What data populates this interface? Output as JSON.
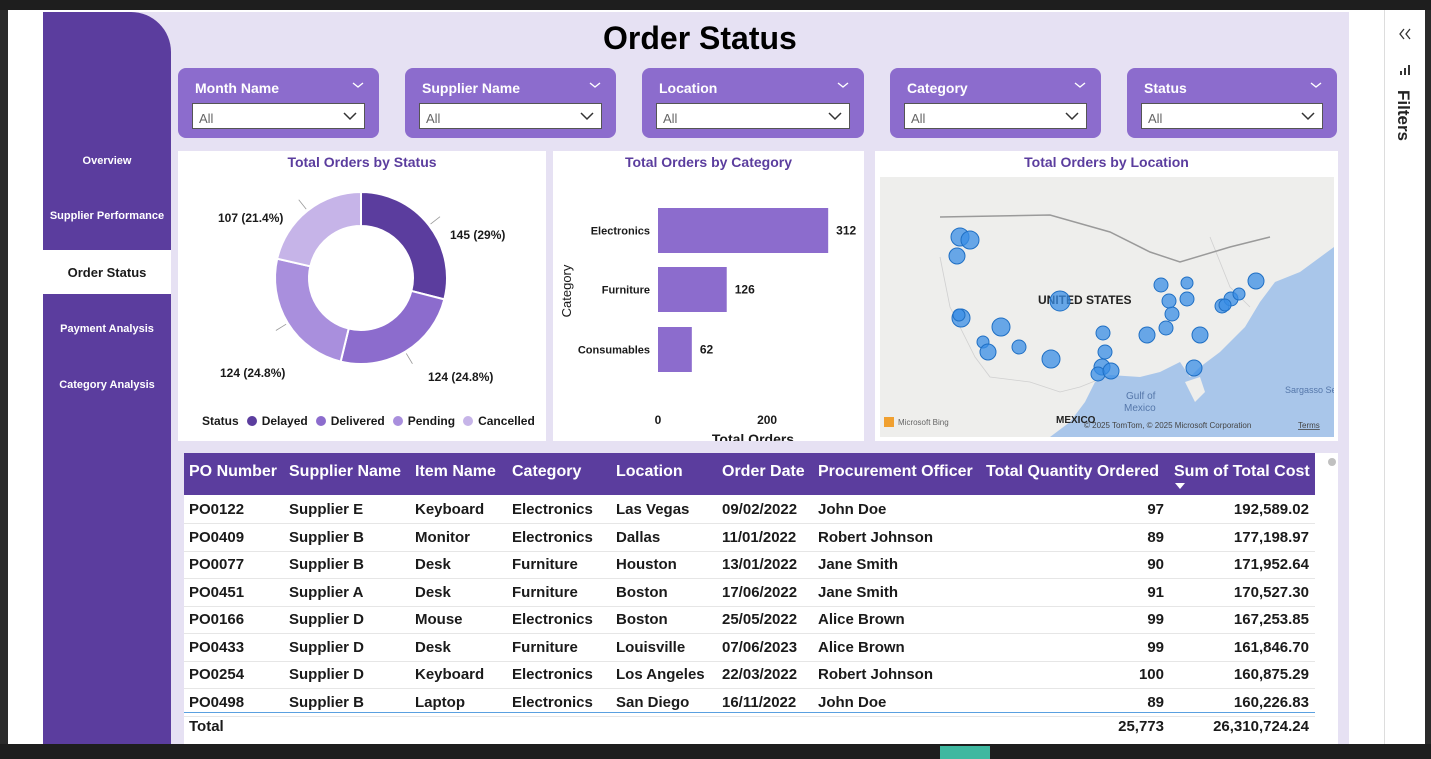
{
  "report": {
    "title": "Order Status"
  },
  "nav": {
    "items": [
      {
        "label": "Overview"
      },
      {
        "label": "Supplier Performance"
      },
      {
        "label": "Order Status"
      },
      {
        "label": "Payment Analysis"
      },
      {
        "label": "Category Analysis"
      }
    ],
    "active": "Order Status"
  },
  "slicers": [
    {
      "label": "Month Name",
      "value": "All"
    },
    {
      "label": "Supplier Name",
      "value": "All"
    },
    {
      "label": "Location",
      "value": "All"
    },
    {
      "label": "Category",
      "value": "All"
    },
    {
      "label": "Status",
      "value": "All"
    }
  ],
  "filters_pane": {
    "label": "Filters",
    "collapse_icon": "double-chevron-left-icon"
  },
  "colors": {
    "accent": "#5b3d9e",
    "slicer": "#8c6ccd",
    "background": "#e6e1f3",
    "delayed": "#5b3d9e",
    "delivered": "#8c6ccd",
    "pending": "#a98fdd",
    "cancelled": "#c6b4e8",
    "bar": "#8c6ccd",
    "map_point": "#3a8ee6"
  },
  "chart_data": [
    {
      "type": "pie",
      "title": "Total Orders by Status",
      "legend_title": "Status",
      "legend_position": "bottom",
      "categories": [
        "Delayed",
        "Delivered",
        "Pending",
        "Cancelled"
      ],
      "values": [
        145,
        124,
        124,
        107
      ],
      "labels": [
        "145 (29%)",
        "124 (24.8%)",
        "124 (24.8%)",
        "107 (21.4%)"
      ]
    },
    {
      "type": "bar",
      "orientation": "horizontal",
      "title": "Total Orders by Category",
      "xlabel": "Total Orders",
      "ylabel": "Category",
      "categories": [
        "Electronics",
        "Furniture",
        "Consumables"
      ],
      "values": [
        312,
        126,
        62
      ],
      "xticks": [
        "0",
        "200"
      ],
      "xlim": [
        0,
        330
      ]
    }
  ],
  "map": {
    "title": "Total Orders by Location",
    "country_label": "UNITED STATES",
    "labels": [
      "Gulf of Mexico",
      "MEXICO",
      "Sargasso Se"
    ],
    "attribution": "© 2025 TomTom, © 2025 Microsoft Corporation",
    "terms": "Terms",
    "provider": "Microsoft Bing"
  },
  "table": {
    "columns": [
      "PO Number",
      "Supplier Name",
      "Item Name",
      "Category",
      "Location",
      "Order Date",
      "Procurement Officer",
      "Total Quantity Ordered",
      "Sum of Total Cost"
    ],
    "sorted_column": "Sum of Total Cost",
    "rows": [
      [
        "PO0122",
        "Supplier E",
        "Keyboard",
        "Electronics",
        "Las Vegas",
        "09/02/2022",
        "John Doe",
        "97",
        "192,589.02"
      ],
      [
        "PO0409",
        "Supplier B",
        "Monitor",
        "Electronics",
        "Dallas",
        "11/01/2022",
        "Robert Johnson",
        "89",
        "177,198.97"
      ],
      [
        "PO0077",
        "Supplier B",
        "Desk",
        "Furniture",
        "Houston",
        "13/01/2022",
        "Jane Smith",
        "90",
        "171,952.64"
      ],
      [
        "PO0451",
        "Supplier A",
        "Desk",
        "Furniture",
        "Boston",
        "17/06/2022",
        "Jane Smith",
        "91",
        "170,527.30"
      ],
      [
        "PO0166",
        "Supplier D",
        "Mouse",
        "Electronics",
        "Boston",
        "25/05/2022",
        "Alice Brown",
        "99",
        "167,253.85"
      ],
      [
        "PO0433",
        "Supplier D",
        "Desk",
        "Furniture",
        "Louisville",
        "07/06/2023",
        "Alice Brown",
        "99",
        "161,846.70"
      ],
      [
        "PO0254",
        "Supplier D",
        "Keyboard",
        "Electronics",
        "Los Angeles",
        "22/03/2022",
        "Robert Johnson",
        "100",
        "160,875.29"
      ],
      [
        "PO0498",
        "Supplier B",
        "Laptop",
        "Electronics",
        "San Diego",
        "16/11/2022",
        "John Doe",
        "89",
        "160,226.83"
      ]
    ],
    "total": {
      "label": "Total",
      "quantity": "25,773",
      "cost": "26,310,724.24"
    }
  }
}
